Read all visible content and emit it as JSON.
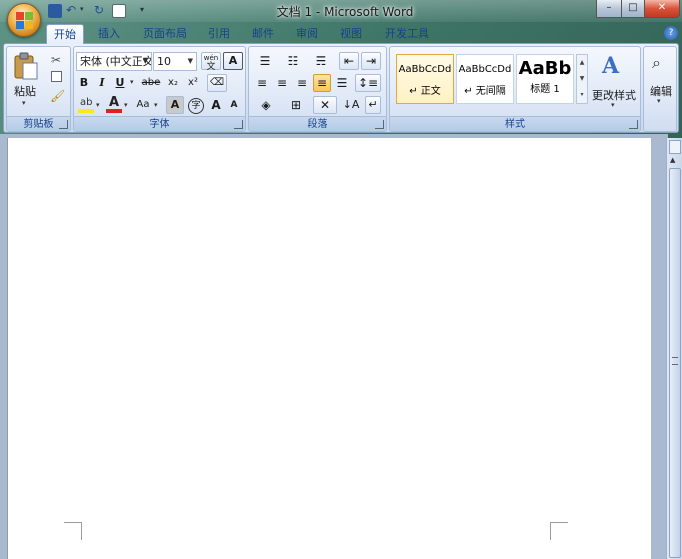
{
  "window": {
    "title": "文档 1 - Microsoft Word",
    "minimize": "–",
    "maximize": "□",
    "close": "✕"
  },
  "tabs": [
    {
      "label": "开始",
      "active": true
    },
    {
      "label": "插入"
    },
    {
      "label": "页面布局"
    },
    {
      "label": "引用"
    },
    {
      "label": "邮件"
    },
    {
      "label": "审阅"
    },
    {
      "label": "视图"
    },
    {
      "label": "开发工具"
    }
  ],
  "clipboard": {
    "paste_label": "粘贴",
    "group_label": "剪贴板"
  },
  "font": {
    "family": "宋体 (中文正文",
    "size": "10",
    "bold": "B",
    "italic": "I",
    "underline": "U",
    "strike": "abe",
    "subscript": "x₂",
    "superscript": "x²",
    "font_color": "A",
    "change_case": "Aa",
    "char_shading": "A",
    "enclose": "字",
    "grow": "A",
    "shrink": "A",
    "group_label": "字体",
    "wen_char": "wén"
  },
  "paragraph": {
    "group_label": "段落"
  },
  "styles": {
    "items": [
      {
        "sample": "AaBbCcDd",
        "name": "↵ 正文"
      },
      {
        "sample": "AaBbCcDd",
        "name": "↵ 无间隔"
      },
      {
        "sample": "AaBb",
        "name": "标题 1"
      }
    ],
    "change_styles": "更改样式",
    "group_label": "样式"
  },
  "editing": {
    "label": "编辑"
  },
  "colors": {
    "accent": "#15428b",
    "font_color_bar": "#e21f1f",
    "highlight_bar": "#f5ed1b"
  }
}
